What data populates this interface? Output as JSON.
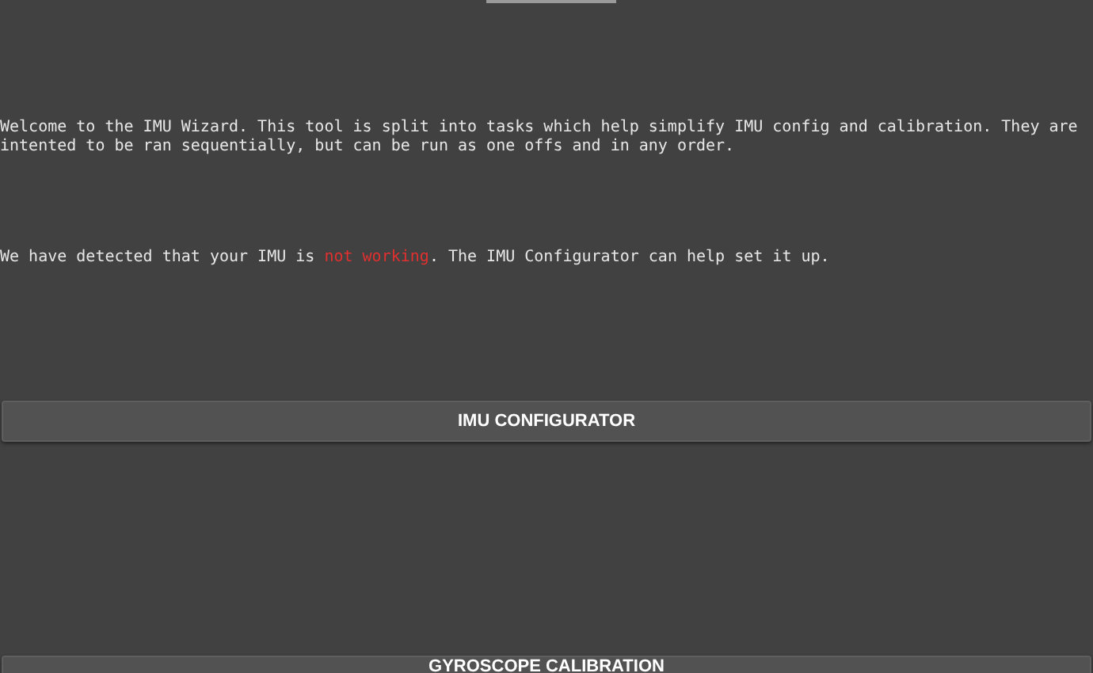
{
  "intro": "Welcome to the IMU Wizard. This tool is split into tasks which help simplify IMU config and calibration. They are intented to be ran sequentially, but can be run as one offs and in any order.",
  "status": [
    {
      "text": "We have detected that your IMU is ",
      "kind": "plain"
    },
    {
      "text": "not working",
      "kind": "alert"
    },
    {
      "text": ". The IMU Configurator can help set it up.",
      "kind": "plain"
    }
  ],
  "buttons": [
    {
      "label": "IMU CONFIGURATOR"
    },
    {
      "label": "GYROSCOPE CALIBRATION"
    }
  ]
}
